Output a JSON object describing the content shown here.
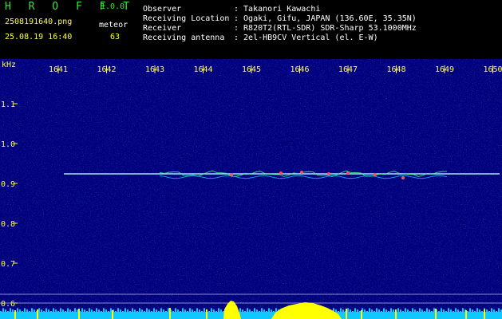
{
  "header": {
    "app_name": "H R O F F T",
    "app_version": "1.0.0",
    "file_name": "2508191640.png",
    "datetime": "25.08.19 16:40",
    "mode_label": "meteor",
    "count": "63",
    "info": [
      {
        "label": "Observer",
        "value": ": Takanori Kawachi"
      },
      {
        "label": "Receiving Location",
        "value": ": Ogaki, Gifu, JAPAN (136.60E, 35.35N)"
      },
      {
        "label": "Receiver",
        "value": ": R820T2(RTL-SDR) SDR-Sharp 53.1000MHz"
      },
      {
        "label": "Receiving antenna",
        "value": ": 2el-HB9CV Vertical (el. E-W)"
      }
    ]
  },
  "spectrogram": {
    "y_unit": "kHz",
    "x_ticks": [
      "1641",
      "1642",
      "1643",
      "1644",
      "1645",
      "1646",
      "1647",
      "1648",
      "1649",
      "1650"
    ],
    "y_ticks": [
      "1.1",
      "1.0",
      "0.9",
      "0.8",
      "0.7",
      "0.6"
    ],
    "colors": {
      "background": "#00007a",
      "trace": "#a0e8ff",
      "spectrum": "#10c8ff",
      "bursts": "#ffff00",
      "text": "#ffff40"
    }
  }
}
